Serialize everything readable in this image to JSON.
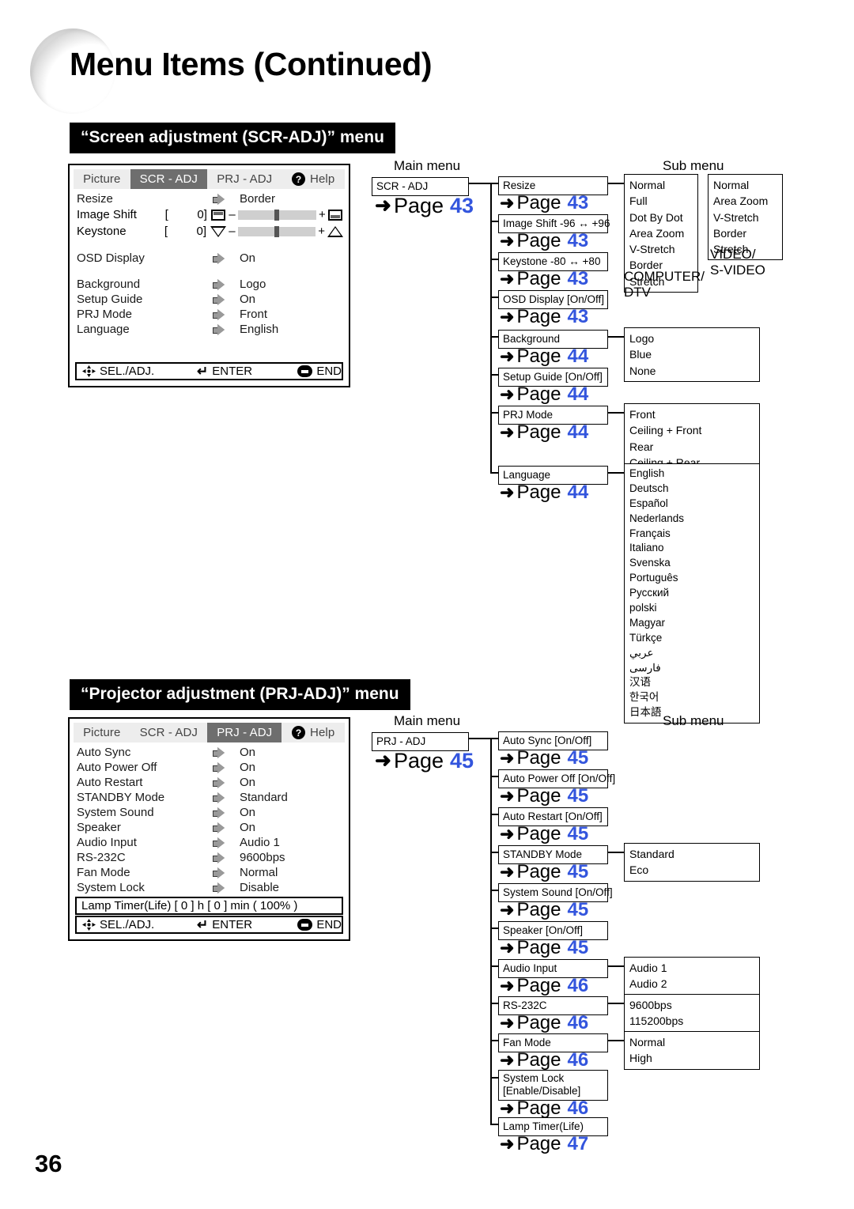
{
  "document": {
    "title": "Menu Items (Continued)",
    "folio": "36"
  },
  "sections": [
    {
      "heading": "“Screen adjustment (SCR-ADJ)” menu",
      "osd": {
        "tabs": [
          {
            "label": "Picture",
            "active": false
          },
          {
            "label": "SCR - ADJ",
            "active": true
          },
          {
            "label": "PRJ - ADJ",
            "active": false
          },
          {
            "label": "Help",
            "active": false,
            "icon": "help-circle-icon"
          }
        ],
        "rows": [
          {
            "label": "Resize",
            "value": "Border",
            "arrow": "gray-right-arrow-icon"
          },
          {
            "label": "OSD Display",
            "value": "On",
            "arrow": "gray-right-arrow-icon"
          },
          {
            "label": "Background",
            "value": "Logo",
            "arrow": "gray-right-arrow-icon"
          },
          {
            "label": "Setup Guide",
            "value": "On",
            "arrow": "gray-right-arrow-icon"
          },
          {
            "label": "PRJ Mode",
            "value": "Front",
            "arrow": "gray-right-arrow-icon"
          },
          {
            "label": "Language",
            "value": "English",
            "arrow": "gray-right-arrow-icon"
          }
        ],
        "sliders": [
          {
            "label": "Image Shift",
            "open": "[",
            "value": "0",
            "close": "]",
            "minus": "–",
            "plus": "+",
            "icon_left": "image-shift-top-icon",
            "icon_right": "image-shift-bottom-icon"
          },
          {
            "label": "Keystone",
            "open": "[",
            "value": "0",
            "close": "]",
            "minus": "–",
            "plus": "+",
            "icon_left": "keystone-narrow-top-icon",
            "icon_right": "keystone-wide-top-icon"
          }
        ],
        "footer": {
          "sel": "SEL./ADJ.",
          "enter": "ENTER",
          "end": "END",
          "enter_glyph": "↵"
        }
      },
      "flow": {
        "col_main": "Main menu",
        "col_sub": "Sub menu",
        "root": {
          "label": "SCR - ADJ",
          "page": "43"
        },
        "items": [
          {
            "label": "Resize",
            "page": "43",
            "sub": [
              "Normal",
              "Full",
              "Dot By Dot",
              "Area Zoom",
              "V-Stretch",
              "Border",
              "Stretch"
            ],
            "sub_caption": "COMPUTER/\nDTV",
            "sub2": [
              "Normal",
              "Area Zoom",
              "V-Stretch",
              "Border",
              "Stretch"
            ],
            "sub2_caption": "VIDEO/\nS-VIDEO"
          },
          {
            "label": "Image Shift    -96 ↔ +96",
            "page": "43"
          },
          {
            "label": "Keystone        -80 ↔ +80",
            "page": "43"
          },
          {
            "label": "OSD Display [On/Off]",
            "page": "43"
          },
          {
            "label": "Background",
            "page": "44",
            "sub": [
              "Logo",
              "Blue",
              "None"
            ]
          },
          {
            "label": "Setup Guide [On/Off]",
            "page": "44"
          },
          {
            "label": "PRJ Mode",
            "page": "44",
            "sub": [
              "Front",
              "Ceiling + Front",
              "Rear",
              "Ceiling + Rear"
            ]
          },
          {
            "label": "Language",
            "page": "44",
            "sub": [
              "English",
              "Deutsch",
              "Español",
              "Nederlands",
              "Français",
              "Italiano",
              "Svenska",
              "Português",
              "Русский",
              "polski",
              "Magyar",
              "Türkçe",
              "عربي",
              "فارسی",
              "汉语",
              "한국어",
              "日本語"
            ]
          }
        ]
      }
    },
    {
      "heading": "“Projector adjustment (PRJ-ADJ)” menu",
      "osd": {
        "tabs": [
          {
            "label": "Picture",
            "active": false
          },
          {
            "label": "SCR - ADJ",
            "active": false
          },
          {
            "label": "PRJ - ADJ",
            "active": true
          },
          {
            "label": "Help",
            "active": false,
            "icon": "help-circle-icon"
          }
        ],
        "rows": [
          {
            "label": "Auto Sync",
            "value": "On",
            "arrow": "gray-right-arrow-icon"
          },
          {
            "label": "Auto Power Off",
            "value": "On",
            "arrow": "gray-right-arrow-icon"
          },
          {
            "label": "Auto Restart",
            "value": "On",
            "arrow": "gray-right-arrow-icon"
          },
          {
            "label": "STANDBY Mode",
            "value": "Standard",
            "arrow": "gray-right-arrow-icon"
          },
          {
            "label": "System Sound",
            "value": "On",
            "arrow": "gray-right-arrow-icon"
          },
          {
            "label": "Speaker",
            "value": "On",
            "arrow": "gray-right-arrow-icon"
          },
          {
            "label": "Audio Input",
            "value": "Audio 1",
            "arrow": "gray-right-arrow-icon"
          },
          {
            "label": "RS-232C",
            "value": "9600bps",
            "arrow": "gray-right-arrow-icon"
          },
          {
            "label": "Fan Mode",
            "value": "Normal",
            "arrow": "gray-right-arrow-icon"
          },
          {
            "label": "System Lock",
            "value": "Disable",
            "arrow": "gray-right-arrow-icon"
          }
        ],
        "lamp_timer": "Lamp Timer(Life) [        0 ] h        [     0 ] min ( 100% )",
        "footer": {
          "sel": "SEL./ADJ.",
          "enter": "ENTER",
          "end": "END",
          "enter_glyph": "↵"
        }
      },
      "flow": {
        "col_main": "Main menu",
        "col_sub": "Sub menu",
        "root": {
          "label": "PRJ - ADJ",
          "page": "45"
        },
        "items": [
          {
            "label": "Auto Sync [On/Off]",
            "page": "45"
          },
          {
            "label": "Auto Power Off [On/Off]",
            "page": "45"
          },
          {
            "label": "Auto Restart [On/Off]",
            "page": "45"
          },
          {
            "label": "STANDBY Mode",
            "page": "45",
            "sub": [
              "Standard",
              "Eco"
            ]
          },
          {
            "label": "System Sound [On/Off]",
            "page": "45"
          },
          {
            "label": "Speaker [On/Off]",
            "page": "45"
          },
          {
            "label": "Audio Input",
            "page": "46",
            "sub": [
              "Audio 1",
              "Audio 2"
            ]
          },
          {
            "label": "RS-232C",
            "page": "46",
            "sub": [
              "9600bps",
              "115200bps"
            ]
          },
          {
            "label": "Fan Mode",
            "page": "46",
            "sub": [
              "Normal",
              "High"
            ]
          },
          {
            "label": "System Lock\n[Enable/Disable]",
            "page": "46"
          },
          {
            "label": "Lamp Timer(Life)",
            "page": "47"
          }
        ]
      }
    }
  ],
  "colors": {
    "page_link_blue": "#3355dd",
    "tab_active_bg": "#6e6e6e",
    "tab_bar_bg": "#ededed",
    "section_bar_bg": "#000000"
  }
}
